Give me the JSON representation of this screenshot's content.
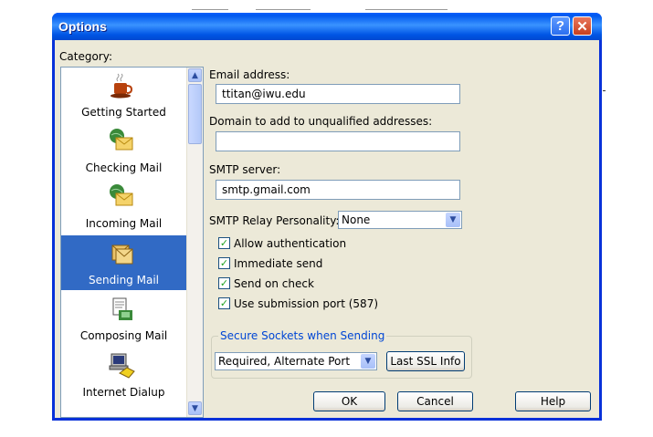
{
  "window": {
    "title": "Options"
  },
  "category": {
    "label": "Category:",
    "items": [
      {
        "label": "Getting Started",
        "icon": "coffee-cup-icon"
      },
      {
        "label": "Checking Mail",
        "icon": "mail-globe-icon"
      },
      {
        "label": "Incoming Mail",
        "icon": "mail-globe-icon"
      },
      {
        "label": "Sending Mail",
        "icon": "sending-mail-icon",
        "selected": true
      },
      {
        "label": "Composing Mail",
        "icon": "composing-mail-icon"
      },
      {
        "label": "Internet Dialup",
        "icon": "computer-phone-icon"
      }
    ]
  },
  "form": {
    "email_label": "Email address:",
    "email_value": "ttitan@iwu.edu",
    "domain_label": "Domain to add to unqualified addresses:",
    "domain_value": "",
    "smtp_label": "SMTP server:",
    "smtp_value": "smtp.gmail.com",
    "relay_label": "SMTP Relay Personality:",
    "relay_value": "None",
    "checkboxes": [
      {
        "label": "Allow authentication",
        "checked": true
      },
      {
        "label": "Immediate send",
        "checked": true
      },
      {
        "label": "Send on check",
        "checked": true
      },
      {
        "label": "Use submission port (587)",
        "checked": true
      }
    ],
    "ssl_group_title": "Secure Sockets when Sending",
    "ssl_value": "Required, Alternate Port",
    "last_ssl_button": "Last SSL Info"
  },
  "buttons": {
    "ok": "OK",
    "cancel": "Cancel",
    "help": "Help"
  },
  "colors": {
    "titlebar": "#0058ee",
    "selection": "#316ac5",
    "group_title": "#0046d5",
    "dialog_bg": "#ece9d8"
  }
}
